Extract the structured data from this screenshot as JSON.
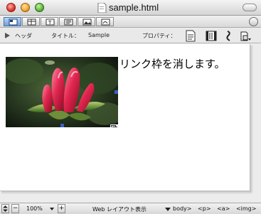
{
  "window": {
    "title": "sample.html"
  },
  "mode_toolbar": {
    "buttons": [
      "layout-view",
      "table-view",
      "text-view",
      "source-view",
      "image-view",
      "pdf-view"
    ],
    "active": "layout-view"
  },
  "property_bar": {
    "head_label": "ヘッダ",
    "title_label": "タイトル：",
    "title_value": "Sample",
    "properties_label": "プロパティ："
  },
  "content": {
    "text": "リンク枠を消します。",
    "image_alt": "red flower buds"
  },
  "status_bar": {
    "zoom": "100%",
    "layout_mode": "Web レイアウト表示",
    "tag_path": [
      "body>",
      "<p>",
      "<a>",
      "<img>"
    ]
  },
  "colors": {
    "accent": "#3b5fc9",
    "active_mode": "#6e9fdc"
  }
}
